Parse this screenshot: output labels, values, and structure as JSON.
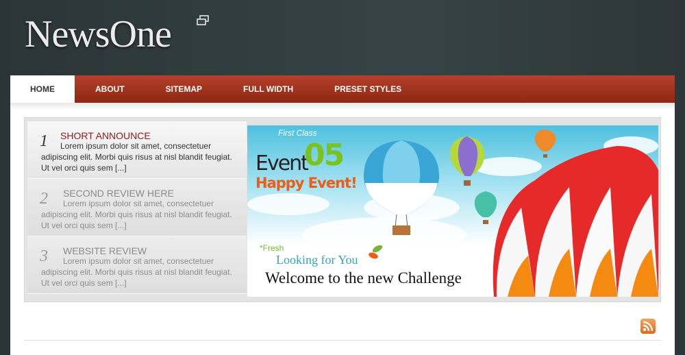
{
  "site": {
    "name": "NewsOne"
  },
  "nav": {
    "items": [
      {
        "label": "HOME",
        "active": true
      },
      {
        "label": "ABOUT",
        "active": false
      },
      {
        "label": "SITEMAP",
        "active": false
      },
      {
        "label": "FULL WIDTH",
        "active": false
      },
      {
        "label": "PRESET STYLES",
        "active": false
      }
    ]
  },
  "slider": {
    "items": [
      {
        "num": "1",
        "title": "SHORT ANNOUNCE",
        "desc": "Lorem ipsum dolor sit amet, consectetuer adipiscing elit. Morbi quis risus at nisl blandit feugiat. Ut vel orci quis sem [...]"
      },
      {
        "num": "2",
        "title": "SECOND REVIEW HERE",
        "desc": "Lorem ipsum dolor sit amet, consectetuer adipiscing elit. Morbi quis risus at nisl blandit feugiat. Ut vel orci quis sem [...]"
      },
      {
        "num": "3",
        "title": "WEBSITE REVIEW",
        "desc": "Lorem ipsum dolor sit amet, consectetuer adipiscing elit. Morbi quis risus at nisl blandit feugiat. Ut vel orci quis sem [...]"
      }
    ],
    "banner": {
      "first_class": "First Class",
      "event": "Event",
      "event_num": "05",
      "happy": "Happy Event!",
      "fresh": "*Fresh",
      "looking": "Looking for You",
      "welcome": "Welcome to the new Challenge"
    }
  },
  "colors": {
    "header_bg": "#2f3a3d",
    "nav_red": "#a3341f",
    "announce_title": "#8b1c1c",
    "accent_green": "#7ac21c",
    "accent_orange": "#ee5d14",
    "rss_orange": "#e8751f"
  },
  "icons": {
    "logo_icon": "window-restore-icon",
    "rss_icon": "rss-icon"
  }
}
